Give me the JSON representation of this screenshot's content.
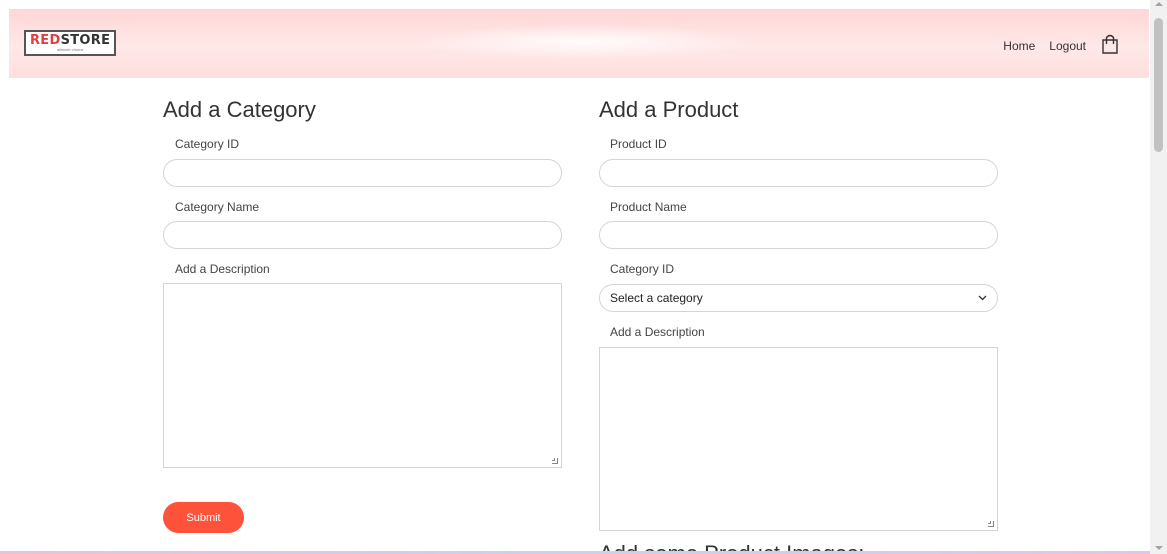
{
  "header": {
    "logo_red": "RED",
    "logo_dark": "STORE",
    "logo_tagline": "alleinite choice",
    "nav": {
      "home": "Home",
      "logout": "Logout"
    }
  },
  "category_form": {
    "title": "Add a Category",
    "category_id_label": "Category ID",
    "category_id_value": "",
    "category_name_label": "Category Name",
    "category_name_value": "",
    "description_label": "Add a Description",
    "description_value": "",
    "submit_label": "Submit"
  },
  "product_form": {
    "title": "Add a Product",
    "product_id_label": "Product ID",
    "product_id_value": "",
    "product_name_label": "Product Name",
    "product_name_value": "",
    "category_id_label": "Category ID",
    "category_select_value": "Select a category",
    "description_label": "Add a Description",
    "description_value": "",
    "images_heading": "Add some Product Images:"
  },
  "colors": {
    "accent": "#ff523b",
    "header_bg": "#ffd6d6"
  },
  "icons": [
    "shopping-bag-icon",
    "chevron-down-icon",
    "resize-grip-icon"
  ]
}
